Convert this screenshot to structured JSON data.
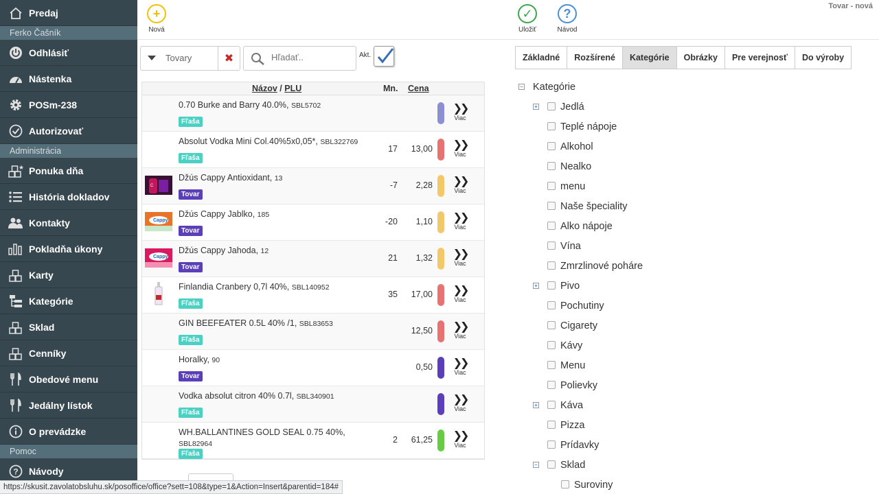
{
  "sidebar": {
    "items": [
      {
        "type": "item",
        "label": "Predaj",
        "icon": "home-icon"
      },
      {
        "type": "section",
        "label": "Ferko Čašník"
      },
      {
        "type": "item",
        "label": "Odhlásiť",
        "icon": "power-icon"
      },
      {
        "type": "item",
        "label": "Nástenka",
        "icon": "dashboard-icon"
      },
      {
        "type": "item",
        "label": "POSm-238",
        "icon": "gear-icon"
      },
      {
        "type": "item",
        "label": "Autorizovať",
        "icon": "check-circle-icon"
      },
      {
        "type": "section",
        "label": "Administrácia"
      },
      {
        "type": "item",
        "label": "Ponuka dňa",
        "icon": "boxes-star-icon"
      },
      {
        "type": "item",
        "label": "História dokladov",
        "icon": "list-icon"
      },
      {
        "type": "item",
        "label": "Kontakty",
        "icon": "users-icon"
      },
      {
        "type": "item",
        "label": "Pokladňa úkony",
        "icon": "bar-chart-icon"
      },
      {
        "type": "item",
        "label": "Karty",
        "icon": "boxes-icon"
      },
      {
        "type": "item",
        "label": "Kategórie",
        "icon": "tree-icon"
      },
      {
        "type": "item",
        "label": "Sklad",
        "icon": "boxes-icon"
      },
      {
        "type": "item",
        "label": "Cenníky",
        "icon": "boxes-icon"
      },
      {
        "type": "item",
        "label": "Obedové menu",
        "icon": "cutlery-icon"
      },
      {
        "type": "item",
        "label": "Jedálny lístok",
        "icon": "cutlery-icon"
      },
      {
        "type": "item",
        "label": "O prevádzke",
        "icon": "info-icon"
      },
      {
        "type": "section",
        "label": "Pomoc"
      },
      {
        "type": "item",
        "label": "Návody",
        "icon": "question-icon"
      }
    ]
  },
  "toolbar": {
    "new_label": "Nová",
    "save_label": "Uložiť",
    "help_label": "Návod",
    "page_title": "Tovar - nová"
  },
  "filter": {
    "type_value": "Tovary",
    "search_placeholder": "Hľadať..",
    "active_label": "Akt.",
    "active_checked": true
  },
  "table": {
    "headers": {
      "name": "Názov",
      "sep": " / ",
      "plu": "PLU",
      "qty": "Mn.",
      "price": "Cena"
    },
    "more_label": "Viac",
    "rows": [
      {
        "name": "0.70 Burke and Barry 40.0%,",
        "plu": "SBL5702",
        "badge": "Fľaša",
        "qty": "",
        "price": "",
        "color": "#8c8fd6",
        "img": ""
      },
      {
        "name": "Absolut Vodka Mini Col.40%5x0,05*,",
        "plu": "SBL322769",
        "badge": "Fľaša",
        "qty": "17",
        "price": "13,00",
        "color": "#e57373",
        "img": ""
      },
      {
        "name": "Džús Cappy Antioxidant,",
        "plu": "13",
        "badge": "Tovar",
        "qty": "-7",
        "price": "2,28",
        "color": "#f4c86a",
        "img": "purple"
      },
      {
        "name": "Džús Cappy Jablko,",
        "plu": "185",
        "badge": "Tovar",
        "qty": "-20",
        "price": "1,10",
        "color": "#f4c86a",
        "img": "orange"
      },
      {
        "name": "Džús Cappy Jahoda,",
        "plu": "12",
        "badge": "Tovar",
        "qty": "21",
        "price": "1,32",
        "color": "#f4c86a",
        "img": "red"
      },
      {
        "name": "Finlandia Cranbery 0,7l 40%,",
        "plu": "SBL140952",
        "badge": "Fľaša",
        "qty": "35",
        "price": "17,00",
        "color": "#e57373",
        "img": "bottle"
      },
      {
        "name": "GIN BEEFEATER 0.5L 40% /1,",
        "plu": "SBL83653",
        "badge": "Fľaša",
        "qty": "",
        "price": "12,50",
        "color": "#e57373",
        "img": ""
      },
      {
        "name": "Horalky,",
        "plu": "90",
        "badge": "Tovar",
        "qty": "",
        "price": "0,50",
        "color": "#5b3fb8",
        "img": ""
      },
      {
        "name": "Vodka absolut citron 40% 0.7l,",
        "plu": "SBL340901",
        "badge": "Fľaša",
        "qty": "",
        "price": "",
        "color": "#5b3fb8",
        "img": ""
      },
      {
        "name": "WH.BALLANTINES GOLD SEAL 0.75 40%,",
        "plu": "SBL82964",
        "badge": "Fľaša",
        "qty": "2",
        "price": "61,25",
        "color": "#66cc44",
        "img": "",
        "wrap": true
      }
    ]
  },
  "badge_colors": {
    "Fľaša": "#4dd0c4",
    "Tovar": "#5b3fb8"
  },
  "tabs": [
    {
      "label": "Základné",
      "active": false
    },
    {
      "label": "Rozšírené",
      "active": false
    },
    {
      "label": "Kategórie",
      "active": true
    },
    {
      "label": "Obrázky",
      "active": false
    },
    {
      "label": "Pre verejnosť",
      "active": false
    },
    {
      "label": "Do výroby",
      "active": false
    }
  ],
  "tree": {
    "root_label": "Kategórie",
    "items": [
      {
        "label": "Jedlá",
        "level": 1,
        "expander": "plus"
      },
      {
        "label": "Teplé nápoje",
        "level": 1
      },
      {
        "label": "Alkohol",
        "level": 1
      },
      {
        "label": "Nealko",
        "level": 1
      },
      {
        "label": "menu",
        "level": 1
      },
      {
        "label": "Naše špeciality",
        "level": 1
      },
      {
        "label": "Alko nápoje",
        "level": 1
      },
      {
        "label": "Vína",
        "level": 1
      },
      {
        "label": "Zmrzlinové poháre",
        "level": 1
      },
      {
        "label": "Pivo",
        "level": 1,
        "expander": "plus"
      },
      {
        "label": "Pochutiny",
        "level": 1
      },
      {
        "label": "Cigarety",
        "level": 1
      },
      {
        "label": "Kávy",
        "level": 1
      },
      {
        "label": "Menu",
        "level": 1
      },
      {
        "label": "Polievky",
        "level": 1
      },
      {
        "label": "Káva",
        "level": 1,
        "expander": "plus"
      },
      {
        "label": "Pizza",
        "level": 1
      },
      {
        "label": "Prídavky",
        "level": 1
      },
      {
        "label": "Sklad",
        "level": 1,
        "expander": "minus"
      },
      {
        "label": "Suroviny",
        "level": 2
      }
    ]
  },
  "status_url": "https://skusit.zavolatobsluhu.sk/posoffice/office?sett=108&type=1&Action=Insert&parentid=184#"
}
